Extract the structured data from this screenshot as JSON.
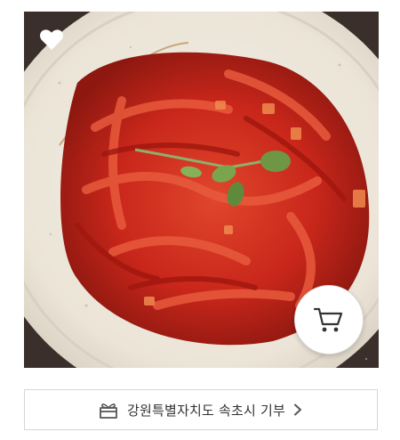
{
  "product": {
    "image_alt": "",
    "wishlist_icon": "heart-icon",
    "cart_icon": "cart-icon"
  },
  "donation": {
    "label": "강원특별자치도 속초시 기부",
    "icon": "gift-box-icon",
    "arrow_icon": "chevron-right-icon"
  },
  "colors": {
    "accent_border": "#d6d6d6",
    "text": "#333333",
    "dish_red": "#c8261a"
  }
}
